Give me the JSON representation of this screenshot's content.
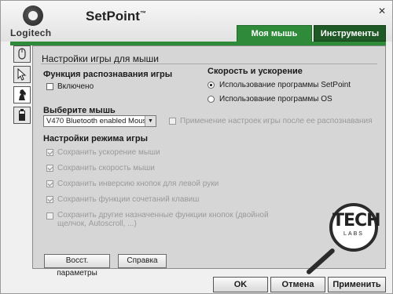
{
  "window": {
    "title": "SetPoint",
    "title_mark": "™",
    "close_label": "✕"
  },
  "logo": {
    "text": "Logitech"
  },
  "tabs": [
    {
      "label": "Моя мышь",
      "active": true
    },
    {
      "label": "Инструменты",
      "active": false
    }
  ],
  "sidebar": {
    "icons": [
      "mouse-icon",
      "pointer-icon",
      "chess-knight-icon",
      "battery-icon"
    ]
  },
  "panel": {
    "title": "Настройки игры для мыши",
    "game_detection": {
      "heading": "Функция распознавания игры",
      "enabled_label": "Включено",
      "enabled_checked": false
    },
    "select_mouse": {
      "heading": "Выберите мышь",
      "value": "V470 Bluetooth enabled Mouse",
      "apply_after_detect_label": "Применение настроек игры после ее распознавания"
    },
    "speed": {
      "heading": "Скорость и ускорение",
      "options": [
        {
          "label": "Использование программы SetPoint",
          "selected": true
        },
        {
          "label": "Использование программы OS",
          "selected": false
        }
      ]
    },
    "game_mode": {
      "heading": "Настройки режима игры",
      "options": [
        {
          "label": "Сохранить ускорение мыши",
          "checked": true
        },
        {
          "label": "Сохранить скорость мыши",
          "checked": true
        },
        {
          "label": "Сохранить инверсию кнопок для левой руки",
          "checked": true
        },
        {
          "label": "Сохранить функции сочетаний клавиш",
          "checked": true
        },
        {
          "label": "Сохранить другие назначенные функции кнопок (двойной",
          "label2": "щелчок, Autoscroll, ...)",
          "checked": false
        }
      ]
    },
    "restore_label": "Восст. параметры",
    "help_label": "Справка"
  },
  "footer": {
    "ok_label": "OK",
    "cancel_label": "Отмена",
    "apply_label": "Применить"
  },
  "watermark": {
    "top": "TECH",
    "bottom": "LABS"
  },
  "colors": {
    "accent": "#2f8a3a",
    "accent_dark": "#1f5a26",
    "panel": "#d6d6d6"
  }
}
